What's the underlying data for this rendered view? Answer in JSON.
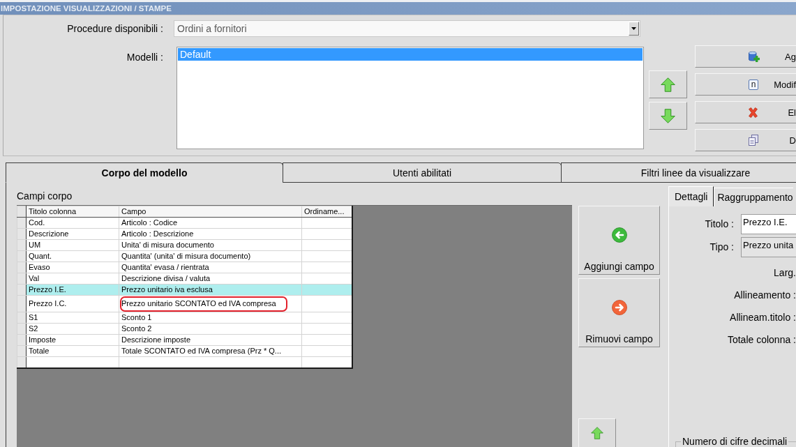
{
  "window": {
    "title": "IMPOSTAZIONE VISUALIZZAZIONI / STAMPE"
  },
  "setup": {
    "procedure": {
      "label": "Procedure disponibili :",
      "value": "Ordini a fornitori"
    },
    "models": {
      "label": "Modelli :",
      "items": [
        {
          "label": "Default",
          "selected": true
        }
      ]
    },
    "actions": [
      {
        "label": "Ag"
      },
      {
        "label": "Modif",
        "icon_text": "n"
      },
      {
        "label": "El"
      },
      {
        "label": "D"
      }
    ]
  },
  "tabs": [
    {
      "label": "Corpo del modello",
      "selected": true
    },
    {
      "label": "Utenti abilitati",
      "selected": false
    },
    {
      "label": "Filtri linee da visualizzare",
      "selected": false
    }
  ],
  "body": {
    "title": "Campi corpo",
    "table": {
      "columns": [
        "Titolo colonna",
        "Campo",
        "Ordiname..."
      ],
      "rows": [
        {
          "title": "Cod.",
          "field": "Articolo : Codice",
          "selected": false,
          "circled": false
        },
        {
          "title": "Descrizione",
          "field": "Articolo : Descrizione",
          "selected": false,
          "circled": false
        },
        {
          "title": "UM",
          "field": "Unita' di misura documento",
          "selected": false,
          "circled": false
        },
        {
          "title": "Quant.",
          "field": "Quantita' (unita' di misura documento)",
          "selected": false,
          "circled": false
        },
        {
          "title": "Evaso",
          "field": "Quantita' evasa / rientrata",
          "selected": false,
          "circled": false
        },
        {
          "title": "Val",
          "field": "Descrizione divisa / valuta",
          "selected": false,
          "circled": false
        },
        {
          "title": "Prezzo I.E.",
          "field": "Prezzo unitario iva esclusa",
          "selected": true,
          "circled": false
        },
        {
          "title": "Prezzo I.C.",
          "field": "Prezzo unitario SCONTATO ed IVA compresa",
          "selected": false,
          "circled": true
        },
        {
          "title": "S1",
          "field": "Sconto 1",
          "selected": false,
          "circled": false
        },
        {
          "title": "S2",
          "field": "Sconto 2",
          "selected": false,
          "circled": false
        },
        {
          "title": "Imposte",
          "field": "Descrizione imposte",
          "selected": false,
          "circled": false
        },
        {
          "title": "Totale",
          "field": "Totale SCONTATO ed IVA compresa (Prz * Q...",
          "selected": false,
          "circled": false
        }
      ]
    },
    "buttons": [
      {
        "label": "Aggiungi campo"
      },
      {
        "label": "Rimuovi campo"
      }
    ]
  },
  "details": {
    "tabs": [
      {
        "label": "Dettagli",
        "selected": true
      },
      {
        "label": "Raggruppamento",
        "selected": false
      }
    ],
    "fields": [
      {
        "kind": "input",
        "label": "Titolo :",
        "value": "Prezzo I.E.",
        "disabled": false
      },
      {
        "kind": "input",
        "label": "Tipo :",
        "value": "Prezzo unita",
        "disabled": true
      },
      {
        "kind": "label",
        "label": "Larg."
      },
      {
        "kind": "label",
        "label": "Allineamento :"
      },
      {
        "kind": "label",
        "label": "Allineam.titolo :"
      },
      {
        "kind": "label",
        "label": "Totale colonna :"
      }
    ],
    "group": {
      "label": "Numero di cifre decimali"
    }
  }
}
